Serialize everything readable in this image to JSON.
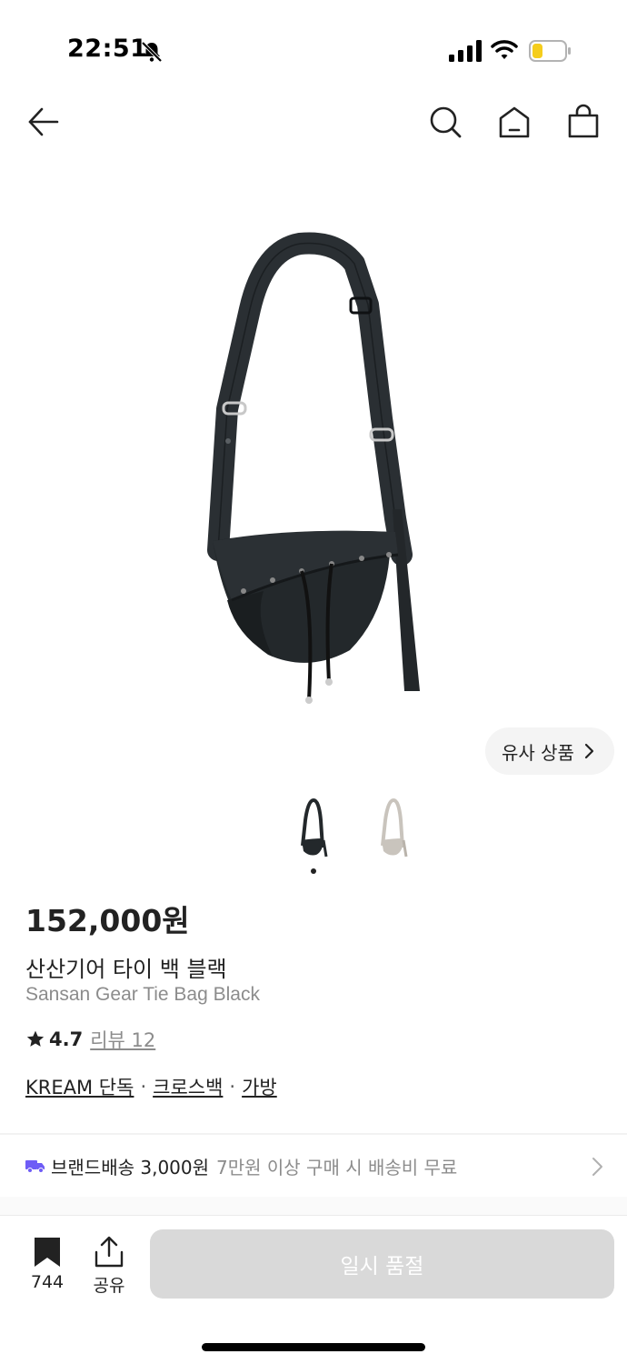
{
  "status_bar": {
    "time": "22:51"
  },
  "nav": {
    "icons": [
      "arrow-left-icon",
      "search-icon",
      "home-icon",
      "shopping-bag-icon"
    ]
  },
  "product": {
    "similar_button_label": "유사 상품",
    "price": "152,000원",
    "name_ko": "산산기어 타이 백 블랙",
    "name_en": "Sansan Gear Tie Bag Black",
    "rating": "4.7",
    "review_label": "리뷰 12",
    "tags": [
      "KREAM 단독",
      "크로스백",
      "가방"
    ],
    "thumbnails": [
      "black",
      "beige"
    ]
  },
  "shipping": {
    "label": "브랜드배송 3,000원",
    "note": "7만원 이상 구매 시 배송비 무료"
  },
  "bottom_bar": {
    "bookmark_count": "744",
    "share_label": "공유",
    "soldout_label": "일시 품절"
  },
  "colors": {
    "accent_purple": "#6e5cf6",
    "soldout_bg": "#d9d9d9",
    "text_primary": "#222222",
    "text_secondary": "#8c8c8c"
  }
}
